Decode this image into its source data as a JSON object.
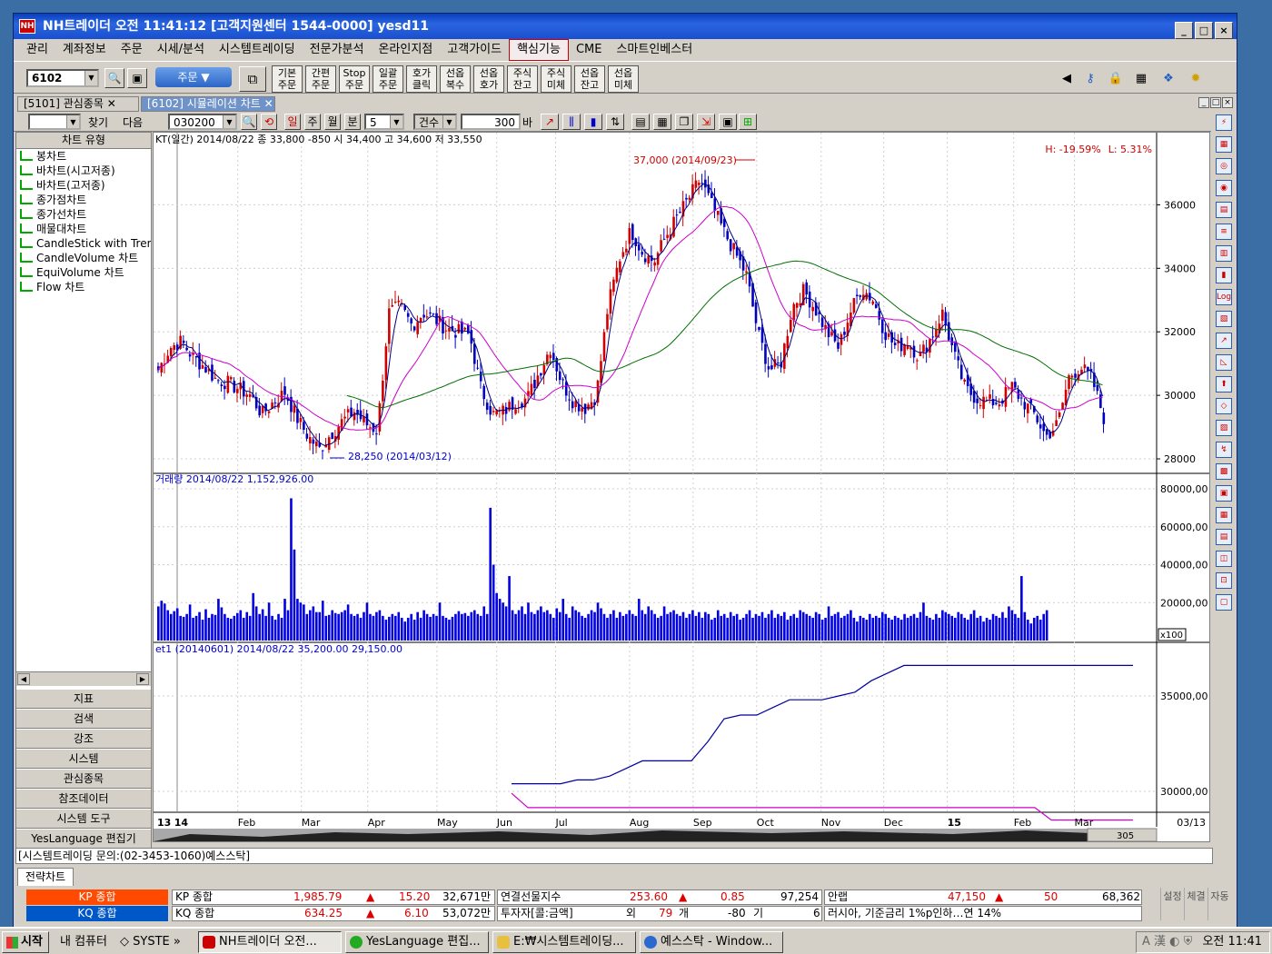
{
  "window": {
    "title": "NH트레이더  오전 11:41:12  [고객지원센터 1544-0000]  yesd11",
    "icon": "NH"
  },
  "menu": [
    "관리",
    "계좌정보",
    "주문",
    "시세/분석",
    "시스템트레이딩",
    "전문가분석",
    "온라인지점",
    "고객가이드",
    "핵심기능",
    "CME",
    "스마트인베스터"
  ],
  "menu_selected": "핵심기능",
  "toolbar": {
    "screen_no": "6102",
    "order_label": "주문",
    "buttons": [
      [
        "기본",
        "주문"
      ],
      [
        "간편",
        "주문"
      ],
      [
        "Stop",
        "주문"
      ],
      [
        "일괄",
        "주문"
      ],
      [
        "호가",
        "클릭"
      ],
      [
        "선옵",
        "복수"
      ],
      [
        "선옵",
        "호가"
      ],
      [
        "주식",
        "잔고"
      ],
      [
        "주식",
        "미체"
      ],
      [
        "선옵",
        "잔고"
      ],
      [
        "선옵",
        "미체"
      ]
    ]
  },
  "tabs": [
    {
      "label": "[5101] 관심종목"
    },
    {
      "label": "[6102] 시뮬레이션 차트"
    }
  ],
  "chart_toolbar": {
    "find": "찾기",
    "next": "다음",
    "code": "030200",
    "periods": [
      "일",
      "주",
      "월",
      "분"
    ],
    "minute": "5",
    "count_mode": "건수",
    "count": "300",
    "unit": "바"
  },
  "left_panel": {
    "title": "차트 유형",
    "items": [
      "봉차트",
      "바차트(시고저종)",
      "바차트(고저종)",
      "종가점차트",
      "종가선차트",
      "매물대차트",
      "CandleStick with Trend",
      "CandleVolume 차트",
      "EquiVolume 차트",
      "Flow 차트"
    ],
    "buttons": [
      "지표",
      "검색",
      "강조",
      "시스템",
      "관심종목",
      "참조데이터",
      "시스템 도구",
      "YesLanguage 편집기"
    ]
  },
  "price_panel": {
    "header": "KT(일간) 2014/08/22  종 33,800 -850  시 34,400 고 34,600 저 33,550",
    "high_rate": "H: -19.59%",
    "low_rate": "L: 5.31%",
    "high_label": "37,000 (2014/09/23)",
    "low_label": "28,250 (2014/03/12)",
    "y_ticks": [
      "36000",
      "34000",
      "32000",
      "30000",
      "28000"
    ]
  },
  "volume_panel": {
    "header": "거래량  2014/08/22 1,152,926.00",
    "y_ticks": [
      "80000,00",
      "60000,00",
      "40000,00",
      "20000,00"
    ],
    "scale": "x100"
  },
  "indicator_panel": {
    "header": "et1  (20140601) 2014/08/22 35,200.00 29,150.00",
    "y_ticks": [
      "35000,00",
      "30000,00"
    ]
  },
  "x_axis": {
    "labels": [
      "13",
      "14",
      "Feb",
      "Mar",
      "Apr",
      "May",
      "Jun",
      "Jul",
      "Aug",
      "Sep",
      "Oct",
      "Nov",
      "Dec",
      "15",
      "Feb",
      "Mar"
    ],
    "right_date": "03/13",
    "zoom": "305"
  },
  "status_line": "[시스템트레이딩 문의:(02-3453-1060)예스스탁]",
  "strategy_tab": "전략차트",
  "ticker": {
    "row1": {
      "tag": "KP 종합",
      "name": "KP 종합",
      "value": "1,985.79",
      "change": "15.20",
      "volume": "32,671만",
      "name2": "연결선물지수",
      "value2": "253.60",
      "change2": "0.85",
      "volume2": "97,254",
      "name3": "안랩",
      "value3": "47,150",
      "change3": "50",
      "volume3": "68,362"
    },
    "row2": {
      "tag": "KQ 종합",
      "name": "KQ 종합",
      "value": "634.25",
      "change": "6.10",
      "volume": "53,072만",
      "name2": "투자자[콜:금액]",
      "v_label": "외",
      "v_val": "79",
      "v_label2": "개",
      "v_val2": "-80",
      "v_label3": "기",
      "v_val3": "6",
      "news": "러시아, 기준금리 1%p인하…연 14%"
    },
    "side": [
      "설정",
      "체결",
      "자동"
    ]
  },
  "taskbar": {
    "start": "시작",
    "quick": "내 컴퓨터",
    "quick2": "SYSTE",
    "tasks": [
      "NH트레이더  오전...",
      "YesLanguage 편집...",
      "E:₩시스템트레이딩...",
      "예스스탁 - Window..."
    ],
    "clock": "오전 11:41"
  },
  "colors": {
    "up": "#d00000",
    "down": "#0000c0",
    "ma_short": "#000080",
    "ma_mid": "#cc00cc",
    "ma_long": "#007000",
    "volume": "#0000e0"
  },
  "chart_data": [
    {
      "type": "candlestick",
      "title": "KT(일간) 2014/08/22",
      "y_range": [
        27600,
        37700
      ],
      "high": {
        "value": 37000,
        "date": "2014/09/23"
      },
      "low": {
        "value": 28250,
        "date": "2014/03/12"
      },
      "close_path": [
        30800,
        31500,
        31700,
        31200,
        30900,
        30500,
        30400,
        30200,
        30000,
        29400,
        29800,
        30100,
        29300,
        28700,
        28300,
        28800,
        29200,
        29500,
        29100,
        28900,
        32600,
        32800,
        32200,
        32600,
        32400,
        32100,
        32000,
        31900,
        30200,
        29400,
        29500,
        29800,
        29900,
        30700,
        31500,
        30400,
        29800,
        29600,
        30000,
        32800,
        34300,
        35200,
        34500,
        34200,
        35000,
        35600,
        36200,
        36800,
        36000,
        35200,
        34500,
        33800,
        32000,
        30800,
        31000,
        32800,
        33300,
        32700,
        32000,
        31500,
        32600,
        33400,
        33000,
        32000,
        31500,
        31700,
        31200,
        31800,
        32600,
        31300,
        30200,
        29900,
        29800,
        29800,
        30300,
        29800,
        29400,
        28700,
        29100,
        30600,
        30900,
        30500,
        29300
      ]
    },
    {
      "type": "bar",
      "title": "거래량",
      "y_range": [
        0,
        80000
      ],
      "unit": "x100",
      "values": [
        18000,
        21000,
        19500,
        16000,
        14000,
        15500,
        17000,
        13000,
        12500,
        14000,
        19000,
        12000,
        13000,
        15000,
        11000,
        16500,
        12000,
        14000,
        13500,
        22000,
        17500,
        14000,
        12000,
        11500,
        13000,
        14500,
        16000,
        12000,
        15000,
        13000,
        25000,
        18000,
        14000,
        16500,
        13000,
        20000,
        13000,
        11000,
        14000,
        12000,
        22000,
        16000,
        75000,
        48000,
        22000,
        20000,
        19000,
        14000,
        16000,
        18000,
        15000,
        15000,
        21000,
        13000,
        13500,
        16000,
        14500,
        14000,
        15000,
        16000,
        19000,
        14000,
        13000,
        14000,
        12000,
        15000,
        20000,
        14000,
        13000,
        15000,
        16000,
        13000,
        11000,
        12500,
        14000,
        13000,
        15000,
        12000,
        10000,
        12000,
        14000,
        11000,
        15000,
        12000,
        16000,
        14000,
        12500,
        14000,
        13000,
        20000,
        13000,
        12000,
        11000,
        12500,
        14000,
        15500,
        14000,
        14500,
        13000,
        15000,
        16000,
        14000,
        13000,
        18000,
        14000,
        70000,
        40000,
        25000,
        22000,
        20000,
        18000,
        34000,
        16000,
        14000,
        16000,
        18000,
        14000,
        20000,
        15000,
        14000,
        16000,
        18000,
        15000,
        16000,
        14000,
        12000,
        17000,
        15000,
        22000,
        14000,
        12000,
        18000,
        16000,
        15000,
        13000,
        12000,
        14000,
        16000,
        15000,
        20000,
        17000,
        14000,
        12000,
        14000,
        16000,
        12000,
        15000,
        13000,
        14000,
        16000,
        14000,
        13000,
        22000,
        16000,
        14000,
        18000,
        16000,
        14000,
        12000,
        13000,
        18000,
        14000,
        15000,
        16000,
        14000,
        13000,
        15000,
        12000,
        14000,
        16000,
        13000,
        15000,
        12000,
        15000,
        14000,
        11000,
        12000,
        16000,
        13000,
        14000,
        12000,
        15000,
        13000,
        14000,
        11000,
        12000,
        14000,
        16000,
        12000,
        14000,
        13000,
        15000,
        12000,
        14000,
        16000,
        12000,
        14000,
        13000,
        15000,
        11000,
        13000,
        14000,
        12000,
        16000,
        15000,
        14000,
        13000,
        12000,
        15000,
        14000,
        11000,
        12000,
        18000,
        13000,
        14000,
        15000,
        12000,
        13000,
        14000,
        16000,
        12000,
        10000,
        13000,
        12000,
        11000,
        14000,
        12000,
        13000,
        12000,
        15000,
        14000,
        12000,
        11000,
        13000,
        12000,
        11000,
        14000,
        12000,
        13000,
        14000,
        12000,
        15000,
        20000,
        13000,
        12000,
        11000,
        14000,
        12000,
        16000,
        15000,
        14000,
        13000,
        12000,
        15000,
        14000,
        12000,
        11000,
        14000,
        16000,
        12000,
        13000,
        10000,
        12000,
        11000,
        14000,
        13000,
        12000,
        15000,
        12000,
        18000,
        16000,
        14000,
        12000,
        34000,
        15000,
        11000,
        9000,
        12000,
        13000,
        11000,
        14000,
        16000
      ]
    },
    {
      "type": "line",
      "title": "et1",
      "y_range": [
        29000,
        37000
      ],
      "series": [
        {
          "name": "et1",
          "values": [
            30400,
            30400,
            30400,
            30400,
            30600,
            30600,
            30800,
            31200,
            31600,
            31600,
            31600,
            31600,
            32600,
            33800,
            34000,
            34000,
            34400,
            34800,
            34800,
            34800,
            35000,
            35200,
            35800,
            36200,
            36600,
            36600,
            36600,
            36600,
            36600,
            36600,
            36600,
            36600,
            36600,
            36600,
            36600,
            36600,
            36600,
            36600,
            36600
          ]
        },
        {
          "name": "et2",
          "values": [
            29900,
            29150,
            29150,
            29150,
            29150,
            29150,
            29150,
            29150,
            29150,
            29150,
            29150,
            29150,
            29150,
            29150,
            29150,
            29150,
            29150,
            29150,
            29150,
            29150,
            29150,
            29150,
            29150,
            29150,
            29150,
            29150,
            29150,
            29150,
            29150,
            29150,
            29150,
            29150,
            29150,
            28500,
            28500,
            28500,
            28500,
            28500,
            28500
          ]
        }
      ]
    }
  ]
}
